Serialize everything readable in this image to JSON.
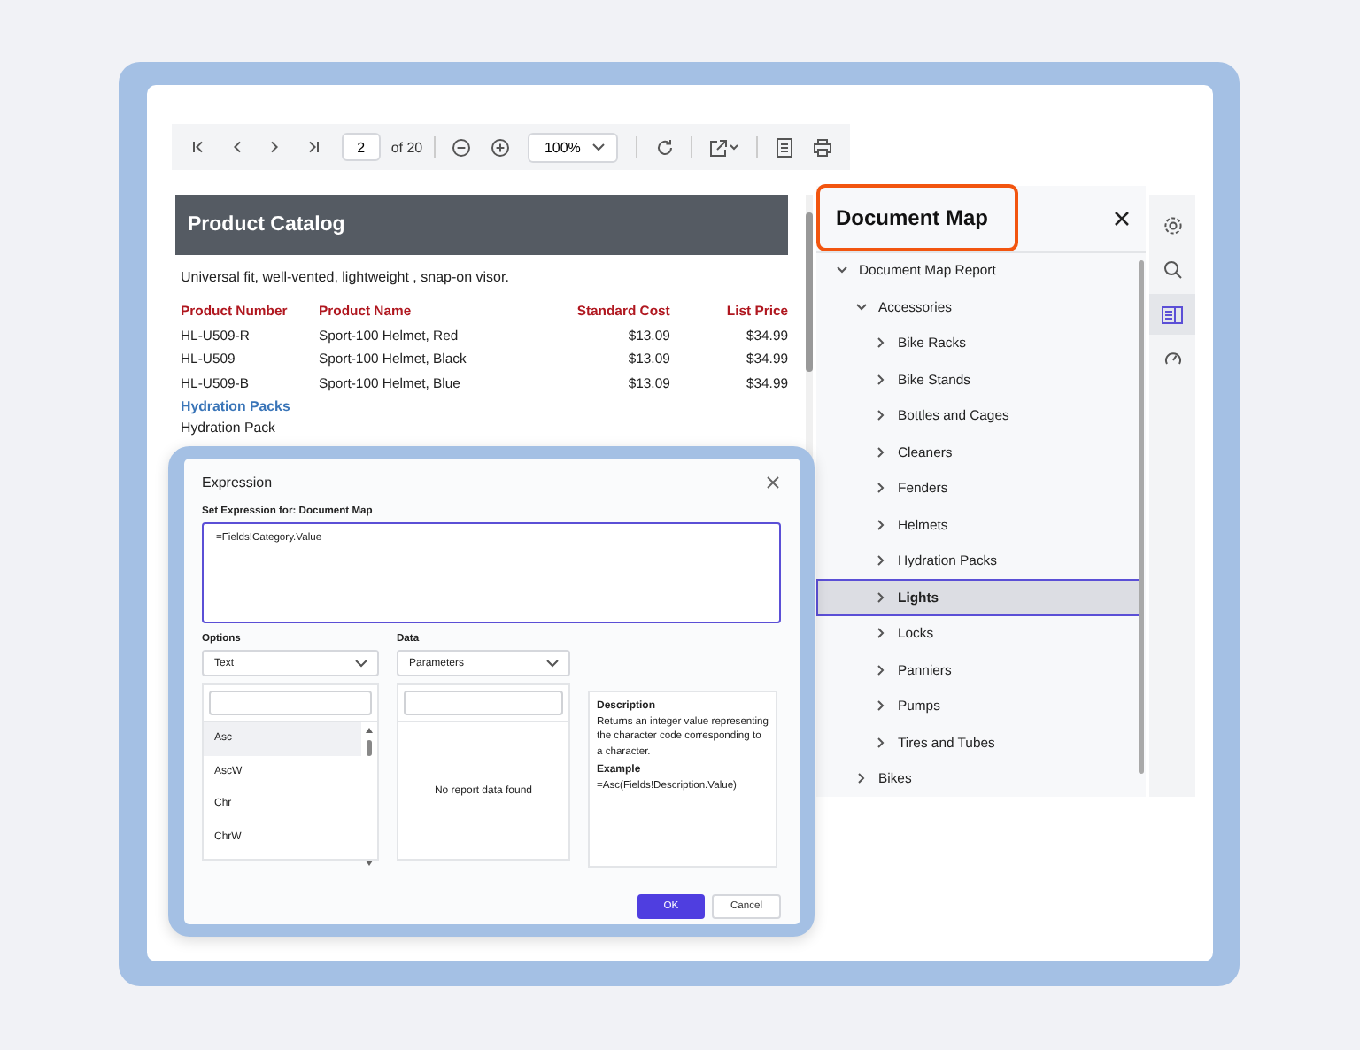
{
  "toolbar": {
    "items": [
      {
        "kind": "first"
      },
      {
        "kind": "prev"
      },
      {
        "kind": "next"
      },
      {
        "kind": "last"
      },
      {
        "kind": "page",
        "value": "2",
        "suffix": "of 20"
      },
      {
        "kind": "sep"
      },
      {
        "kind": "zoom-out"
      },
      {
        "kind": "zoom-in"
      },
      {
        "kind": "zoom",
        "value": "100%"
      },
      {
        "kind": "sep"
      },
      {
        "kind": "refresh"
      },
      {
        "kind": "sep"
      },
      {
        "kind": "export"
      },
      {
        "kind": "sep"
      },
      {
        "kind": "docmap"
      },
      {
        "kind": "print"
      }
    ]
  },
  "report": {
    "title": "Product Catalog",
    "description": "Universal fit, well-vented, lightweight , snap-on visor.",
    "columns": [
      "Product Number",
      "Product Name",
      "Standard Cost",
      "List Price"
    ],
    "rows": [
      [
        "HL-U509-R",
        "Sport-100 Helmet, Red",
        "$13.09",
        "$34.99"
      ],
      [
        "HL-U509",
        "Sport-100 Helmet, Black",
        "$13.09",
        "$34.99"
      ],
      [
        "HL-U509-B",
        "Sport-100 Helmet, Blue",
        "$13.09",
        "$34.99"
      ]
    ],
    "group": "Hydration Packs",
    "subtitle": "Hydration Pack"
  },
  "document_map": {
    "title": "Document Map",
    "items": [
      {
        "label": "Document Map Report",
        "expanded": true,
        "selected": false,
        "children": [
          {
            "label": "Accessories",
            "expanded": true,
            "selected": false,
            "children": [
              {
                "label": "Bike Racks",
                "expanded": false,
                "selected": false
              },
              {
                "label": "Bike Stands",
                "expanded": false,
                "selected": false
              },
              {
                "label": "Bottles and Cages",
                "expanded": false,
                "selected": false
              },
              {
                "label": "Cleaners",
                "expanded": false,
                "selected": false
              },
              {
                "label": "Fenders",
                "expanded": false,
                "selected": false
              },
              {
                "label": "Helmets",
                "expanded": false,
                "selected": false
              },
              {
                "label": "Hydration Packs",
                "expanded": false,
                "selected": false
              },
              {
                "label": "Lights",
                "expanded": false,
                "selected": true
              },
              {
                "label": "Locks",
                "expanded": false,
                "selected": false
              },
              {
                "label": "Panniers",
                "expanded": false,
                "selected": false
              },
              {
                "label": "Pumps",
                "expanded": false,
                "selected": false
              },
              {
                "label": "Tires and Tubes",
                "expanded": false,
                "selected": false
              }
            ]
          },
          {
            "label": "Bikes",
            "expanded": false,
            "selected": false
          }
        ]
      }
    ]
  },
  "side_rail": [
    {
      "kind": "settings",
      "selected": false
    },
    {
      "kind": "search",
      "selected": false
    },
    {
      "kind": "docmap",
      "selected": true
    },
    {
      "kind": "gauge",
      "selected": false
    }
  ],
  "dialog": {
    "title": "Expression",
    "expression_label": "Set Expression for: Document Map",
    "expression": "=Fields!Category.Value",
    "options_label": "Options",
    "options_value": "Text",
    "data_label": "Data",
    "data_value": "Parameters",
    "functions": [
      {
        "label": "Asc",
        "selected": true
      },
      {
        "label": "AscW",
        "selected": false
      },
      {
        "label": "Chr",
        "selected": false
      },
      {
        "label": "ChrW",
        "selected": false
      }
    ],
    "empty_message": "No report data found",
    "description_title": "Description",
    "description": "Returns an integer value representing the character code corresponding to a character.",
    "example_title": "Example",
    "example": "=Asc(Fields!Description.Value)",
    "buttons": [
      "OK",
      "Cancel"
    ]
  }
}
